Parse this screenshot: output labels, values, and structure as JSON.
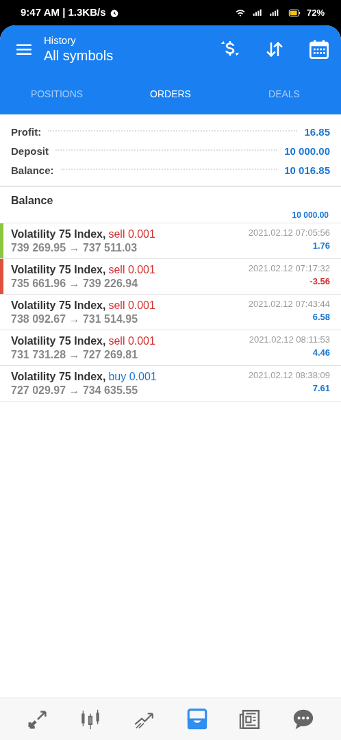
{
  "status_bar": {
    "time": "9:47 AM | 1.3KB/s",
    "battery": "72%"
  },
  "app_bar": {
    "title": "History",
    "subtitle": "All symbols"
  },
  "tabs": [
    {
      "label": "POSITIONS",
      "selected": false
    },
    {
      "label": "ORDERS",
      "selected": true
    },
    {
      "label": "DEALS",
      "selected": false
    }
  ],
  "summary": [
    {
      "label": "Profit:",
      "value": "16.85"
    },
    {
      "label": "Deposit",
      "value": "10 000.00"
    },
    {
      "label": "Balance:",
      "value": "10 016.85"
    }
  ],
  "balance_entry": {
    "label": "Balance",
    "amount": "10 000.00"
  },
  "deals": [
    {
      "symbol": "Volatility 75 Index,",
      "kind": "sell",
      "trade": "sell 0.001",
      "prices": "739 269.95 → 737 511.03",
      "time": "2021.02.12 07:05:56",
      "profit": "1.76",
      "loss": false,
      "color": "#8cc63f"
    },
    {
      "symbol": "Volatility 75 Index,",
      "kind": "sell",
      "trade": "sell 0.001",
      "prices": "735 661.96 → 739 226.94",
      "time": "2021.02.12 07:17:32",
      "profit": "-3.56",
      "loss": true,
      "color": "#e0503c"
    },
    {
      "symbol": "Volatility 75 Index,",
      "kind": "sell",
      "trade": "sell 0.001",
      "prices": "738 092.67 → 731 514.95",
      "time": "2021.02.12 07:43:44",
      "profit": "6.58",
      "loss": false
    },
    {
      "symbol": "Volatility 75 Index,",
      "kind": "sell",
      "trade": "sell 0.001",
      "prices": "731 731.28 → 727 269.81",
      "time": "2021.02.12 08:11:53",
      "profit": "4.46",
      "loss": false
    },
    {
      "symbol": "Volatility 75 Index,",
      "kind": "buy",
      "trade": "buy 0.001",
      "prices": "727 029.97 → 734 635.55",
      "time": "2021.02.12 08:38:09",
      "profit": "7.61",
      "loss": false
    }
  ],
  "bottom_nav": [
    {
      "kind": "quotes",
      "selected": false
    },
    {
      "kind": "chart",
      "selected": false
    },
    {
      "kind": "trade",
      "selected": false
    },
    {
      "kind": "history",
      "selected": true
    },
    {
      "kind": "news",
      "selected": false
    },
    {
      "kind": "chat",
      "selected": false
    }
  ]
}
